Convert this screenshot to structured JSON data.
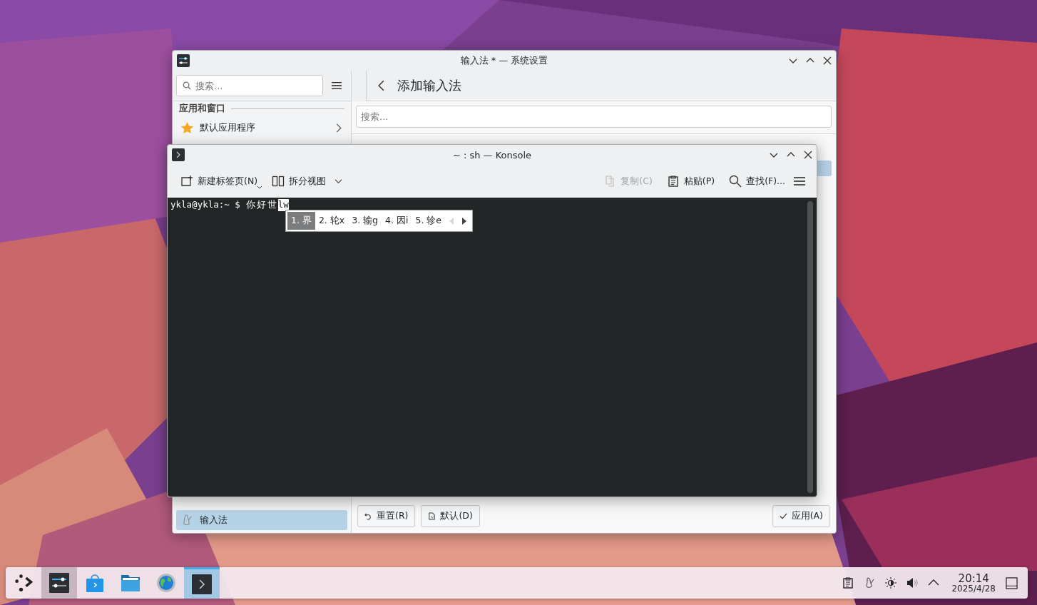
{
  "settings_window": {
    "title": "输入法 * — 系统设置",
    "search": {
      "placeholder": "搜索..."
    },
    "page_title": "添加输入法",
    "page_search": {
      "placeholder": "搜索..."
    },
    "sidebar": {
      "section": "应用和窗口",
      "items": [
        {
          "label": "默认应用程序",
          "kind": "star",
          "selected": false,
          "chevron": true
        },
        {
          "label": "输入法",
          "kind": "input",
          "selected": true,
          "chevron": false
        }
      ]
    },
    "buttons": [
      {
        "label": "重置(R)",
        "kind": "reset"
      },
      {
        "label": "默认(D)",
        "kind": "default"
      },
      {
        "label": "应用(A)",
        "kind": "apply"
      }
    ]
  },
  "konsole": {
    "title": "~ : sh — Konsole",
    "toolbar": [
      {
        "label": "新建标签页(N)",
        "kind": "new-tab",
        "disabled": false,
        "menu": true
      },
      {
        "label": "拆分视图",
        "kind": "split",
        "disabled": false,
        "menu": true
      }
    ],
    "toolbar_right": [
      {
        "label": "复制(C)",
        "kind": "copy",
        "disabled": true
      },
      {
        "label": "粘贴(P)",
        "kind": "paste",
        "disabled": false
      },
      {
        "label": "查找(F)...",
        "kind": "find",
        "disabled": false
      }
    ],
    "terminal": {
      "prompt": "ykla@ykla:~ $",
      "committed": "你好世",
      "preedit": "lw"
    },
    "candidates": {
      "items": [
        {
          "label": "1. 界",
          "selected": true
        },
        {
          "label": "2. 轮x",
          "selected": false
        },
        {
          "label": "3. 输g",
          "selected": false
        },
        {
          "label": "4. 因i",
          "selected": false
        },
        {
          "label": "5. 轸e",
          "selected": false
        }
      ],
      "prev_enabled": false,
      "next_enabled": true
    }
  },
  "taskbar": {
    "apps": [
      {
        "kind": "launcher",
        "highlighted": false,
        "selected": false
      },
      {
        "kind": "settings",
        "highlighted": true,
        "selected": false
      },
      {
        "kind": "store",
        "highlighted": false,
        "selected": false
      },
      {
        "kind": "files",
        "highlighted": false,
        "selected": false
      },
      {
        "kind": "globe",
        "highlighted": false,
        "selected": false
      },
      {
        "kind": "terminal",
        "highlighted": false,
        "selected": true
      }
    ],
    "tray": [
      {
        "kind": "clipboard"
      },
      {
        "kind": "input"
      },
      {
        "kind": "brightness"
      },
      {
        "kind": "volume"
      },
      {
        "kind": "expand"
      }
    ],
    "clock": {
      "time": "20:14",
      "date": "2025/4/28"
    }
  }
}
